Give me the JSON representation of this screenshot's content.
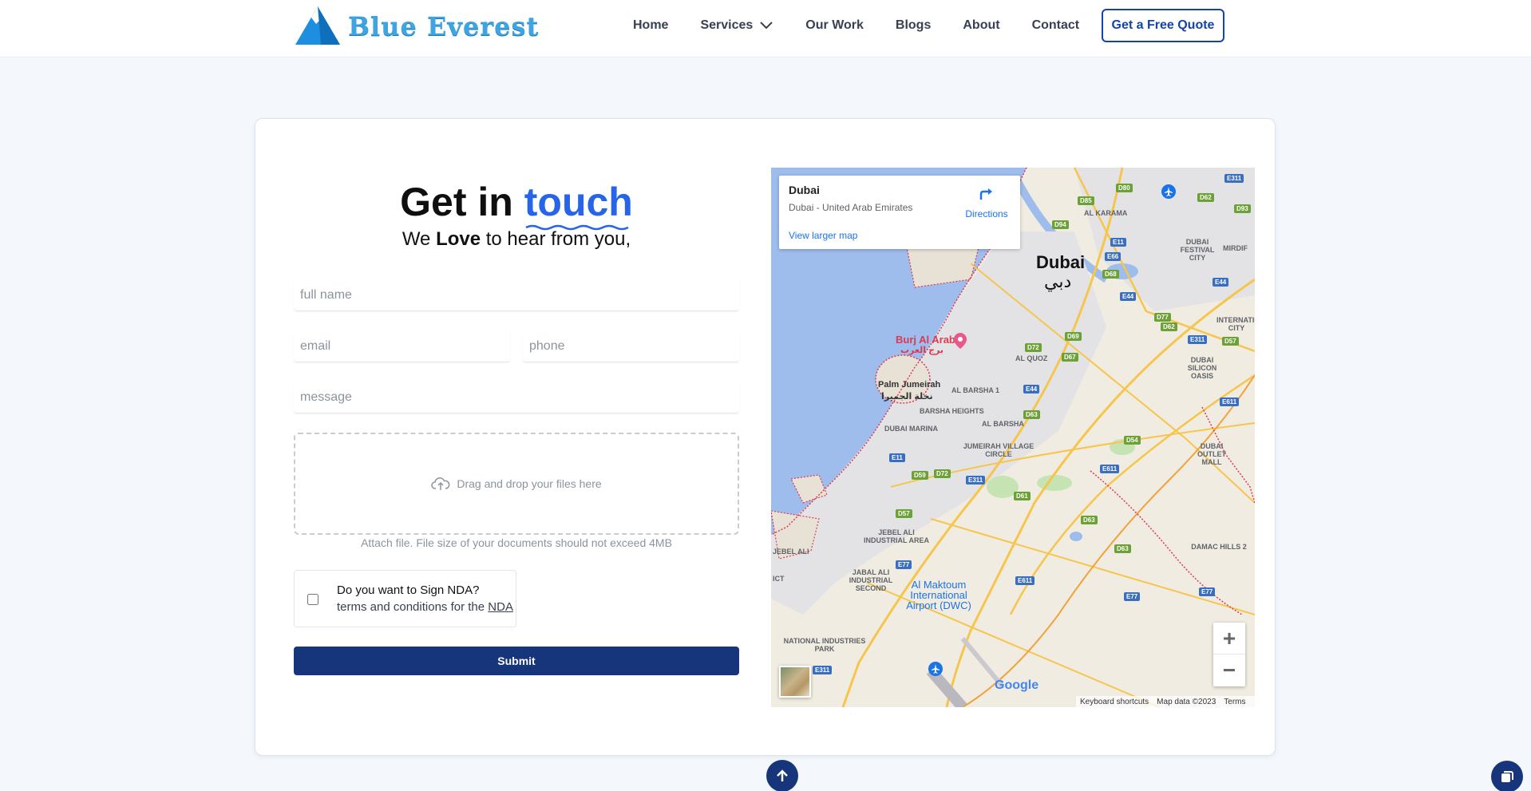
{
  "header": {
    "logo_text": "Blue Everest",
    "nav": {
      "home": "Home",
      "services": "Services",
      "our_work": "Our Work",
      "blogs": "Blogs",
      "about": "About",
      "contact": "Contact"
    },
    "quote_button": "Get a Free Quote"
  },
  "contact": {
    "heading_prefix": "Get in",
    "heading_accent": "touch",
    "sub_prefix": "We",
    "sub_bold": "Love",
    "sub_suffix": "to hear from you,",
    "fields": {
      "full_name_placeholder": "full name",
      "email_placeholder": "email",
      "phone_placeholder": "phone",
      "message_placeholder": "message"
    },
    "dropzone_text": "Drag and drop your files here",
    "attach_hint": "Attach file. File size of your documents should not exceed 4MB",
    "nda_question": "Do you want to Sign NDA?",
    "nda_terms_prefix": "terms and conditions for the",
    "nda_link": "NDA",
    "submit_label": "Submit"
  },
  "map": {
    "place_name": "Dubai",
    "place_address": "Dubai - United Arab Emirates",
    "directions_label": "Directions",
    "larger_map_label": "View larger map",
    "city_label": "Dubai",
    "city_label_ar": "دبي",
    "burj_label": "Burj Al Arab",
    "burj_label_ar": "برج العرب",
    "palm_label": "Palm Jumeirah",
    "palm_label_ar": "نخلة الجميرا",
    "airport_label": "Al Maktoum International Airport (DWC)",
    "labels": {
      "al_karama": "AL KARAMA",
      "festival_city": "DUBAI FESTIVAL CITY",
      "mirdif": "MIRDIF",
      "international_city": "INTERNATIONAL CITY",
      "al_quoz": "AL QUOZ",
      "al_barsha_1": "AL BARSHA 1",
      "barsha_heights": "BARSHA HEIGHTS",
      "al_barsha": "AL BARSHA",
      "dubai_marina": "DUBAI MARINA",
      "jvc": "JUMEIRAH VILLAGE CIRCLE",
      "silicon_oasis": "DUBAI SILICON OASIS",
      "outlet_mall": "DUBAI OUTLET MALL",
      "jebel_ali_ind": "JEBEL ALI INDUSTRIAL AREA",
      "jebel_ali_ind2": "JABAL ALI INDUSTRIAL SECOND",
      "damac_hills": "DAMAC HILLS 2",
      "national_ind": "NATIONAL INDUSTRIES PARK",
      "jebel_ali": "JEBEL ALI",
      "ict": "ICT"
    },
    "google_logo": "Google",
    "footer": {
      "shortcuts": "Keyboard shortcuts",
      "map_data": "Map data ©2023",
      "terms": "Terms"
    },
    "zoom_in": "+",
    "zoom_out": "−"
  },
  "colors": {
    "brand_dark": "#17357a",
    "accent": "#2764e8",
    "map_water": "#9ebcec"
  }
}
